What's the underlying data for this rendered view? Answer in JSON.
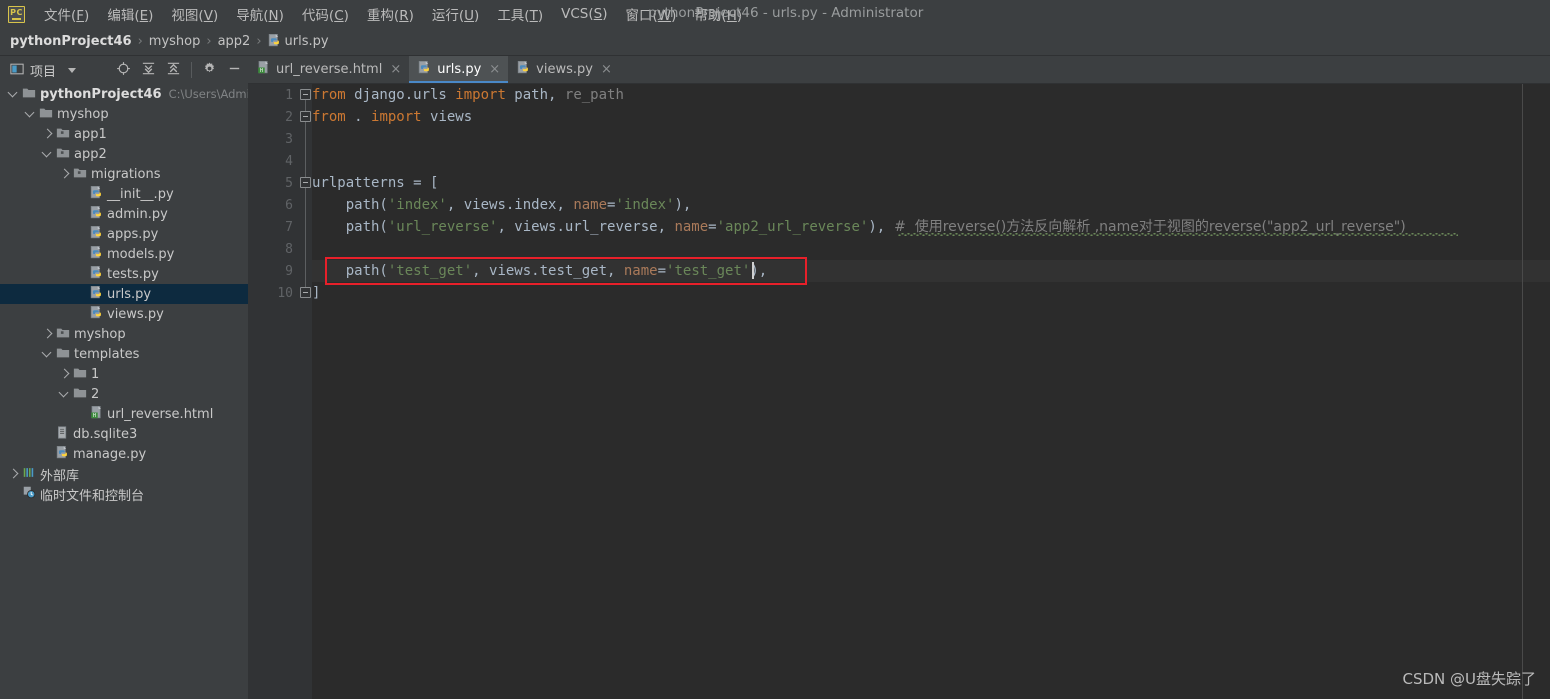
{
  "window": {
    "title": "pythonProject46 - urls.py - Administrator",
    "logo_text": "PC"
  },
  "menubar": {
    "items": [
      {
        "name": "file",
        "label": "文件(F)",
        "plain": "文件(",
        "mnemonic": "F",
        "tail": ")"
      },
      {
        "name": "edit",
        "label": "编辑(E)",
        "plain": "编辑(",
        "mnemonic": "E",
        "tail": ")"
      },
      {
        "name": "view",
        "label": "视图(V)",
        "plain": "视图(",
        "mnemonic": "V",
        "tail": ")"
      },
      {
        "name": "navigate",
        "label": "导航(N)",
        "plain": "导航(",
        "mnemonic": "N",
        "tail": ")"
      },
      {
        "name": "code",
        "label": "代码(C)",
        "plain": "代码(",
        "mnemonic": "C",
        "tail": ")"
      },
      {
        "name": "refactor",
        "label": "重构(R)",
        "plain": "重构(",
        "mnemonic": "R",
        "tail": ")"
      },
      {
        "name": "run",
        "label": "运行(U)",
        "plain": "运行(",
        "mnemonic": "U",
        "tail": ")"
      },
      {
        "name": "tools",
        "label": "工具(T)",
        "plain": "工具(",
        "mnemonic": "T",
        "tail": ")"
      },
      {
        "name": "vcs",
        "label": "VCS(S)",
        "plain": "VCS(",
        "mnemonic": "S",
        "tail": ")"
      },
      {
        "name": "window",
        "label": "窗口(W)",
        "plain": "窗口(",
        "mnemonic": "W",
        "tail": ")"
      },
      {
        "name": "help",
        "label": "帮助(H)",
        "plain": "帮助(",
        "mnemonic": "H",
        "tail": ")"
      }
    ]
  },
  "breadcrumb": {
    "separator": "›",
    "items": [
      {
        "label": "pythonProject46",
        "icon": ""
      },
      {
        "label": "myshop",
        "icon": ""
      },
      {
        "label": "app2",
        "icon": ""
      },
      {
        "label": "urls.py",
        "icon": "python-file-icon"
      }
    ]
  },
  "tool_window": {
    "title": "项目",
    "icons": [
      "project-panel-icon",
      "chevron-down-icon",
      "locate-icon",
      "expand-all-icon",
      "collapse-all-icon",
      "settings-gear-icon",
      "minimize-icon"
    ]
  },
  "tabs": [
    {
      "label": "url_reverse.html",
      "icon": "html-file-icon",
      "active": false,
      "close": "×"
    },
    {
      "label": "urls.py",
      "icon": "python-file-icon",
      "active": true,
      "close": "×"
    },
    {
      "label": "views.py",
      "icon": "python-file-icon",
      "active": false,
      "close": "×"
    }
  ],
  "project_tree": [
    {
      "label": "pythonProject46",
      "sub": "C:\\Users\\Adminis",
      "depth": 0,
      "twisty": "expanded",
      "icon": "folder-icon",
      "bold": true,
      "selected": false
    },
    {
      "label": "myshop",
      "sub": "",
      "depth": 1,
      "twisty": "expanded",
      "icon": "folder-icon",
      "bold": false,
      "selected": false
    },
    {
      "label": "app1",
      "sub": "",
      "depth": 2,
      "twisty": "collapsed",
      "icon": "module-folder-icon",
      "bold": false,
      "selected": false
    },
    {
      "label": "app2",
      "sub": "",
      "depth": 2,
      "twisty": "expanded",
      "icon": "module-folder-icon",
      "bold": false,
      "selected": false
    },
    {
      "label": "migrations",
      "sub": "",
      "depth": 3,
      "twisty": "collapsed",
      "icon": "module-folder-icon",
      "bold": false,
      "selected": false
    },
    {
      "label": "__init__.py",
      "sub": "",
      "depth": 4,
      "twisty": "none",
      "icon": "python-file-icon",
      "bold": false,
      "selected": false
    },
    {
      "label": "admin.py",
      "sub": "",
      "depth": 4,
      "twisty": "none",
      "icon": "python-file-icon",
      "bold": false,
      "selected": false
    },
    {
      "label": "apps.py",
      "sub": "",
      "depth": 4,
      "twisty": "none",
      "icon": "python-file-icon",
      "bold": false,
      "selected": false
    },
    {
      "label": "models.py",
      "sub": "",
      "depth": 4,
      "twisty": "none",
      "icon": "python-file-icon",
      "bold": false,
      "selected": false
    },
    {
      "label": "tests.py",
      "sub": "",
      "depth": 4,
      "twisty": "none",
      "icon": "python-file-icon",
      "bold": false,
      "selected": false
    },
    {
      "label": "urls.py",
      "sub": "",
      "depth": 4,
      "twisty": "none",
      "icon": "python-file-icon",
      "bold": false,
      "selected": true
    },
    {
      "label": "views.py",
      "sub": "",
      "depth": 4,
      "twisty": "none",
      "icon": "python-file-icon",
      "bold": false,
      "selected": false
    },
    {
      "label": "myshop",
      "sub": "",
      "depth": 2,
      "twisty": "collapsed",
      "icon": "module-folder-icon",
      "bold": false,
      "selected": false
    },
    {
      "label": "templates",
      "sub": "",
      "depth": 2,
      "twisty": "expanded",
      "icon": "folder-icon",
      "bold": false,
      "selected": false
    },
    {
      "label": "1",
      "sub": "",
      "depth": 3,
      "twisty": "collapsed",
      "icon": "folder-icon",
      "bold": false,
      "selected": false
    },
    {
      "label": "2",
      "sub": "",
      "depth": 3,
      "twisty": "expanded",
      "icon": "folder-icon",
      "bold": false,
      "selected": false
    },
    {
      "label": "url_reverse.html",
      "sub": "",
      "depth": 4,
      "twisty": "none",
      "icon": "html-file-icon",
      "bold": false,
      "selected": false
    },
    {
      "label": "db.sqlite3",
      "sub": "",
      "depth": 2,
      "twisty": "none",
      "icon": "db-file-icon",
      "bold": false,
      "selected": false
    },
    {
      "label": "manage.py",
      "sub": "",
      "depth": 2,
      "twisty": "none",
      "icon": "python-file-icon",
      "bold": false,
      "selected": false
    },
    {
      "label": "外部库",
      "sub": "",
      "depth": 0,
      "twisty": "collapsed",
      "icon": "library-icon",
      "bold": false,
      "selected": false
    },
    {
      "label": "临时文件和控制台",
      "sub": "",
      "depth": 0,
      "twisty": "none",
      "icon": "scratches-icon",
      "bold": false,
      "selected": false
    }
  ],
  "editor": {
    "filename": "urls.py",
    "line_numbers": [
      "1",
      "2",
      "3",
      "4",
      "5",
      "6",
      "7",
      "8",
      "9",
      "10"
    ],
    "lines": [
      {
        "n": 1,
        "text": "from django.urls import path, re_path"
      },
      {
        "n": 2,
        "text": "from . import views"
      },
      {
        "n": 3,
        "text": ""
      },
      {
        "n": 4,
        "text": ""
      },
      {
        "n": 5,
        "text": "urlpatterns = ["
      },
      {
        "n": 6,
        "text": "    path('index', views.index, name='index'),"
      },
      {
        "n": 7,
        "text": "    path('url_reverse', views.url_reverse, name='app2_url_reverse'),  #  使用reverse()方法反向解析 ,name对于视图的reverse(\"app2_url_reverse\")"
      },
      {
        "n": 8,
        "text": ""
      },
      {
        "n": 9,
        "text": "    path('test_get', views.test_get, name='test_get'),"
      },
      {
        "n": 10,
        "text": "]"
      }
    ],
    "tokens": {
      "l1_kw_from": "from",
      "l1_module": " django.urls ",
      "l1_kw_import": "import",
      "l1_path": " path",
      "l1_comma": ",",
      "l1_repath": " re_path",
      "l2_kw_from": "from",
      "l2_dot": " . ",
      "l2_kw_import": "import",
      "l2_views": " views",
      "l5_text": "urlpatterns = [",
      "l6_call": "    path(",
      "l6_str1": "'index'",
      "l6_mid": ", views.index, ",
      "l6_param": "name",
      "l6_eq": "=",
      "l6_str2": "'index'",
      "l6_end": "),",
      "l7_call": "    path(",
      "l7_str1": "'url_reverse'",
      "l7_mid": ", views.url_reverse, ",
      "l7_param": "name",
      "l7_eq": "=",
      "l7_str2": "'app2_url_reverse'",
      "l7_end": "),",
      "l7_comment": "  #  使用reverse()方法反向解析 ,name对于视图的reverse(\"app2_url_reverse\")",
      "l9_call": "    path(",
      "l9_str1": "'test_get'",
      "l9_mid": ", views.test_get, ",
      "l9_param": "name",
      "l9_eq": "=",
      "l9_str2": "'test_get'",
      "l9_end": "),",
      "l10_text": "]"
    },
    "annotation": {
      "type": "red-rectangle",
      "target_line": 9,
      "color": "#e8202a"
    },
    "caret": {
      "line": 9,
      "column": 53
    }
  },
  "watermark": {
    "text": "CSDN @U盘失踪了"
  },
  "colors": {
    "chrome_bg": "#3c3f41",
    "editor_bg": "#2b2b2b",
    "gutter_bg": "#313335",
    "selection_bg": "#0d2a3f",
    "tab_active_bg": "#4e5254",
    "tab_underline": "#4a88c7",
    "keyword": "#cc7832",
    "string": "#6a8759",
    "param": "#aa7a5a",
    "comment": "#808080",
    "text": "#a9b7c6",
    "annotation": "#e8202a"
  }
}
